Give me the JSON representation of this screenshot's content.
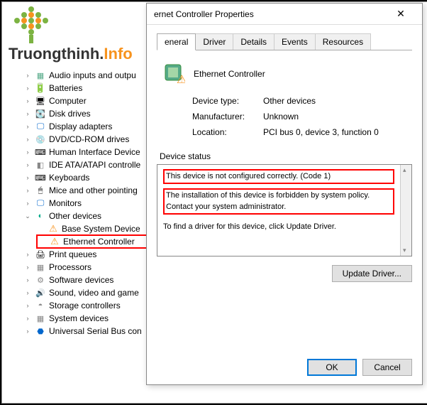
{
  "logo": {
    "text1": "Truongthinh.",
    "text2": "Info"
  },
  "tree": {
    "items": [
      {
        "icon": "ic-chip",
        "label": "Audio inputs and outpu",
        "chev": ">"
      },
      {
        "icon": "ic-battery",
        "label": "Batteries",
        "chev": ">"
      },
      {
        "icon": "ic-computer",
        "label": "Computer",
        "chev": ">"
      },
      {
        "icon": "ic-disk",
        "label": "Disk drives",
        "chev": ">"
      },
      {
        "icon": "ic-display",
        "label": "Display adapters",
        "chev": ">"
      },
      {
        "icon": "ic-dvd",
        "label": "DVD/CD-ROM drives",
        "chev": ">"
      },
      {
        "icon": "ic-hid",
        "label": "Human Interface Device",
        "chev": ">"
      },
      {
        "icon": "ic-ide",
        "label": "IDE ATA/ATAPI controlle",
        "chev": ">"
      },
      {
        "icon": "ic-keyboard",
        "label": "Keyboards",
        "chev": ">"
      },
      {
        "icon": "ic-mouse",
        "label": "Mice and other pointing",
        "chev": ">"
      },
      {
        "icon": "ic-monitor",
        "label": "Monitors",
        "chev": ">"
      }
    ],
    "other": {
      "label": "Other devices",
      "chev": "v",
      "children": [
        {
          "icon": "ic-warn",
          "label": "Base System Device"
        },
        {
          "icon": "ic-warn",
          "label": "Ethernet Controller",
          "highlighted": true
        }
      ]
    },
    "items2": [
      {
        "icon": "ic-printer",
        "label": "Print queues",
        "chev": ">"
      },
      {
        "icon": "ic-cpu",
        "label": "Processors",
        "chev": ">"
      },
      {
        "icon": "ic-gear",
        "label": "Software devices",
        "chev": ">"
      },
      {
        "icon": "ic-sound",
        "label": "Sound, video and game",
        "chev": ">"
      },
      {
        "icon": "ic-storage",
        "label": "Storage controllers",
        "chev": ">"
      },
      {
        "icon": "ic-system",
        "label": "System devices",
        "chev": ">"
      },
      {
        "icon": "ic-usb",
        "label": "Universal Serial Bus con",
        "chev": ">"
      }
    ]
  },
  "dialog": {
    "title": "ernet Controller Properties",
    "tabs": [
      "eneral",
      "Driver",
      "Details",
      "Events",
      "Resources"
    ],
    "deviceName": "Ethernet Controller",
    "info": {
      "typeLabel": "Device type:",
      "typeValue": "Other devices",
      "mfgLabel": "Manufacturer:",
      "mfgValue": "Unknown",
      "locLabel": "Location:",
      "locValue": "PCI bus 0, device 3, function 0"
    },
    "statusLabel": "Device status",
    "statusLine1": "This device is not configured correctly. (Code 1)",
    "statusLine2": "The installation of this device is forbidden by system policy. Contact your system administrator.",
    "statusLine3": "To find a driver for this device, click Update Driver.",
    "updateBtn": "Update Driver...",
    "okBtn": "OK",
    "cancelBtn": "Cancel"
  }
}
